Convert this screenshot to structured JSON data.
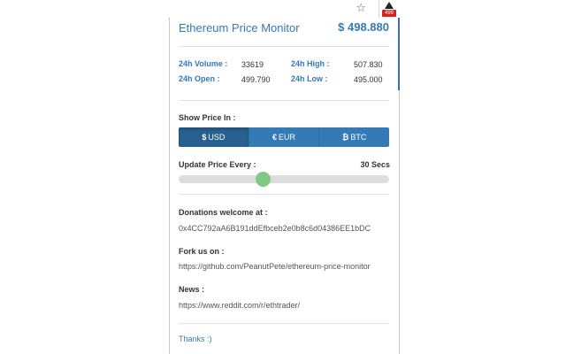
{
  "toolbar": {
    "star_glyph": "☆",
    "extension_badge": "499"
  },
  "header": {
    "title": "Ethereum Price Monitor",
    "price": "$ 498.880"
  },
  "stats": {
    "volume_label": "24h Volume :",
    "volume_value": "33619",
    "high_label": "24h High :",
    "high_value": "507.830",
    "open_label": "24h Open :",
    "open_value": "499.790",
    "low_label": "24h Low :",
    "low_value": "495.000"
  },
  "currency": {
    "label": "Show Price In :",
    "options": [
      {
        "icon": "$",
        "label": "USD",
        "active": true
      },
      {
        "icon": "€",
        "label": "EUR",
        "active": false
      },
      {
        "icon": "₿",
        "label": "BTC",
        "active": false
      }
    ]
  },
  "update": {
    "label": "Update Price Every :",
    "value_text": "30 Secs",
    "slider_fraction": 0.4
  },
  "donations": {
    "label": "Donations welcome at :",
    "address": "0x4CC792aA6B191ddEfbceb2e0b8c6d04386EE1bDC"
  },
  "fork": {
    "label": "Fork us on :",
    "url": "https://github.com/PeanutPete/ethereum-price-monitor"
  },
  "news": {
    "label": "News :",
    "url": "https://www.reddit.com/r/ethtrader/"
  },
  "footer": {
    "thanks": "Thanks :)"
  },
  "colors": {
    "accent": "#337ab7",
    "active_button": "#286090",
    "slider_thumb": "#82c785",
    "badge": "#d61f1f"
  }
}
